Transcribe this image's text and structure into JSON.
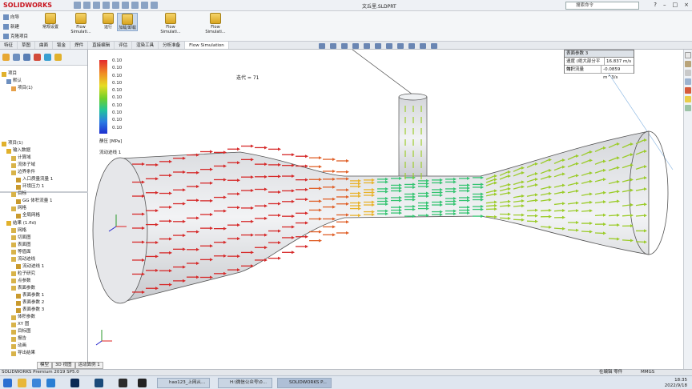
{
  "app": {
    "logo": "SOLIDWORKS",
    "document_title": "文丘里.SLDPRT",
    "search_placeholder": "搜索命令"
  },
  "ribbon": {
    "small_buttons": [
      "向导",
      "新建",
      "克隆项目"
    ],
    "big_buttons": [
      "常规设置",
      "Flow Simulati...",
      "运行",
      "加载/卸载",
      "Flow Simulati...",
      "Flow Simulati..."
    ]
  },
  "tabs": [
    "特征",
    "草图",
    "曲面",
    "钣金",
    "焊件",
    "直接编辑",
    "评估",
    "渲染工具",
    "分析准备",
    "Flow Simulation"
  ],
  "tree_top": [
    {
      "label": "项目",
      "level": 0
    },
    {
      "label": "默认",
      "level": 1
    },
    {
      "label": "项目(1)",
      "level": 2
    }
  ],
  "tree_bottom": [
    {
      "label": "项目(1)",
      "level": 0
    },
    {
      "label": "输入数据",
      "level": 1
    },
    {
      "label": "计算域",
      "level": 2
    },
    {
      "label": "流体子域",
      "level": 2
    },
    {
      "label": "边界条件",
      "level": 2
    },
    {
      "label": "入口质量流量 1",
      "level": 3
    },
    {
      "label": "环境压力 1",
      "level": 3
    },
    {
      "label": "目标",
      "level": 2
    },
    {
      "label": "GG 体积流量 1",
      "level": 3
    },
    {
      "label": "网格",
      "level": 2
    },
    {
      "label": "全局网格",
      "level": 3
    },
    {
      "label": "结果 (1.fld)",
      "level": 1
    },
    {
      "label": "网格",
      "level": 2
    },
    {
      "label": "切面图",
      "level": 2
    },
    {
      "label": "表面图",
      "level": 2
    },
    {
      "label": "等值面",
      "level": 2
    },
    {
      "label": "流动迹线",
      "level": 2
    },
    {
      "label": "流动迹线 1",
      "level": 3
    },
    {
      "label": "粒子研究",
      "level": 2
    },
    {
      "label": "点参数",
      "level": 2
    },
    {
      "label": "表面参数",
      "level": 2
    },
    {
      "label": "表面参数 1",
      "level": 3
    },
    {
      "label": "表面参数 2",
      "level": 3
    },
    {
      "label": "表面参数 3",
      "level": 3
    },
    {
      "label": "体积参数",
      "level": 2
    },
    {
      "label": "XY 图",
      "level": 2
    },
    {
      "label": "目标图",
      "level": 2
    },
    {
      "label": "报告",
      "level": 2
    },
    {
      "label": "动画",
      "level": 2
    },
    {
      "label": "导出结果",
      "level": 2
    }
  ],
  "legend": {
    "values": [
      "0.10",
      "0.10",
      "0.10",
      "0.10",
      "0.10",
      "0.10",
      "0.10",
      "0.10",
      "0.10",
      "0.10"
    ],
    "title": "静压 [MPa]",
    "tracer": "流动迹线 1"
  },
  "iteration": "迭代 = 71",
  "goal_panel": {
    "title": "表面参数 3",
    "rows": [
      {
        "name": "速度 (绝大部分平均)",
        "value": "16.837 m/s"
      },
      {
        "name": "体积流量",
        "value": "-0.0859 m^3/s"
      }
    ]
  },
  "status": {
    "left": "SOLIDWORKS Premium 2019 SP5.0",
    "tabs": [
      "模型",
      "3D 视图",
      "运动算例 1"
    ],
    "editing": "在编辑 零件",
    "units": "MMGS"
  },
  "taskbar": {
    "apps": [
      "hao123_上网从...",
      "H:\\微信公众号\\0...",
      "SOLIDWORKS P..."
    ],
    "time": "18:35",
    "date": "2022/9/18"
  },
  "colors": {
    "high": "#d62a2a",
    "mid": "#36c472",
    "low": "#9ccc2b",
    "accent": "#c8141e"
  }
}
